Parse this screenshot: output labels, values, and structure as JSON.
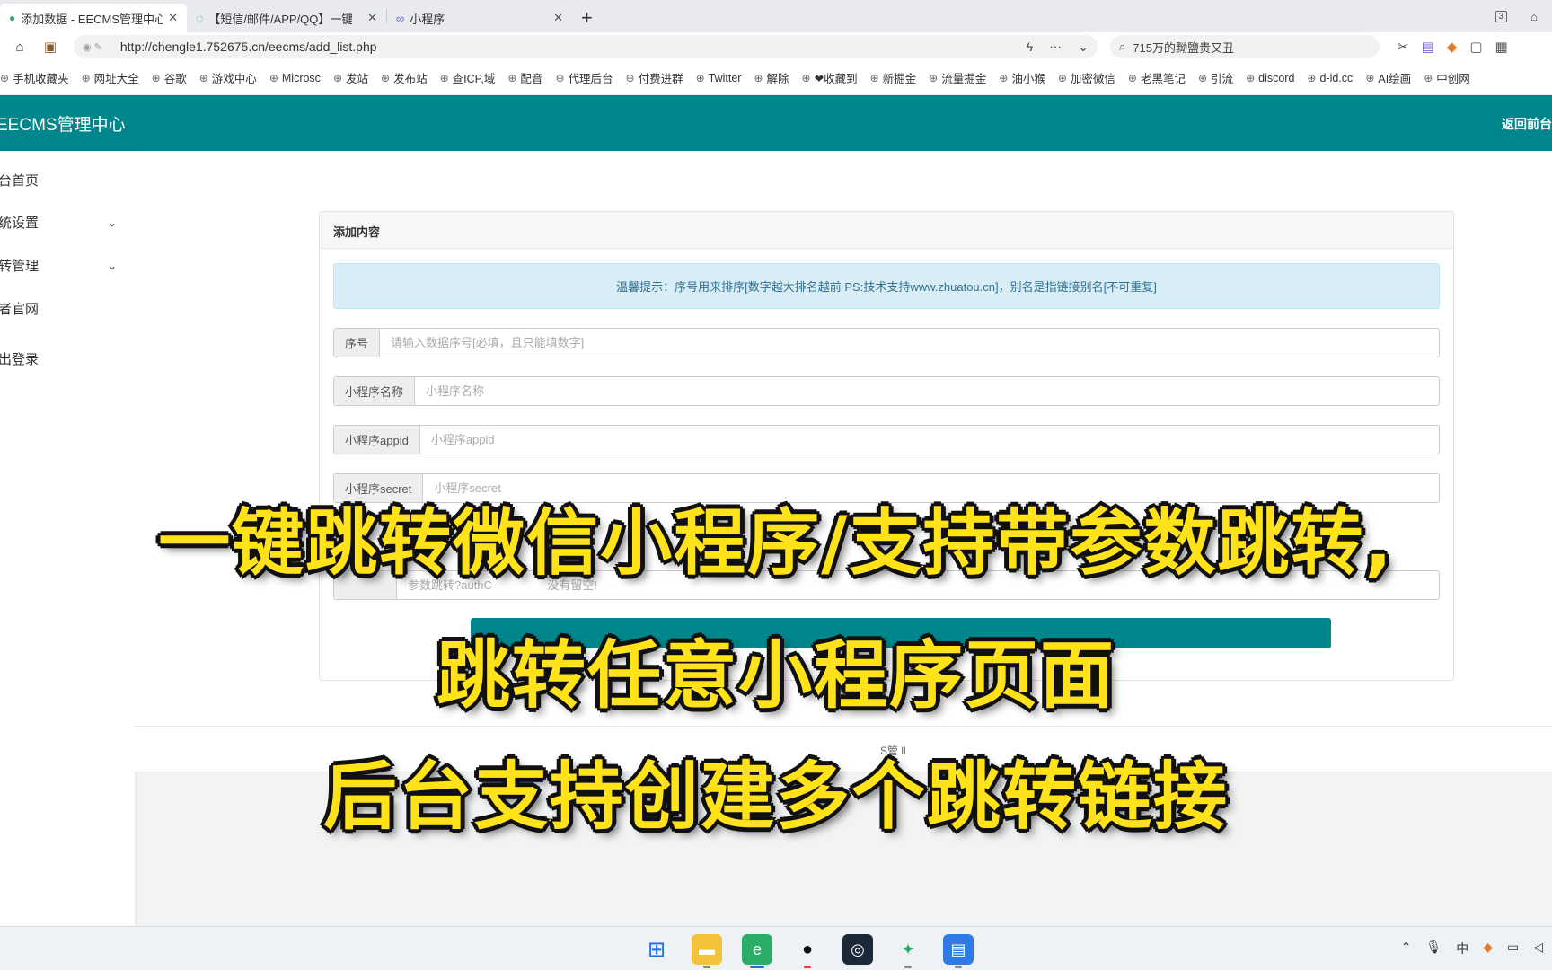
{
  "browser": {
    "tabs": [
      {
        "title": "添加数据 - EECMS管理中心",
        "active": true
      },
      {
        "title": "【短信/邮件/APP/QQ】一键跳",
        "active": false
      },
      {
        "title": "小程序",
        "active": false
      }
    ],
    "new_tab": "+",
    "tab_count_badge": "3",
    "url": "http://chengle1.752675.cn/eecms/add_list.php",
    "search_text": "715万的黝鹽贵又丑",
    "bookmarks": [
      "手机收藏夹",
      "网址大全",
      "谷歌",
      "游戏中心",
      "Microsc",
      "发站",
      "发布站",
      "查ICP,域",
      "配音",
      "代理后台",
      "付费进群",
      "Twitter",
      "解除",
      "❤收藏到",
      "新掘金",
      "流量掘金",
      "油小猴",
      "加密微信",
      "老黑笔记",
      "引流",
      "discord",
      "d-id.cc",
      "AI绘画",
      "中创网"
    ]
  },
  "header": {
    "brand": "EECMS管理中心",
    "back_link": "返回前台"
  },
  "sidebar": {
    "items": [
      {
        "label": "台首页",
        "expandable": false
      },
      {
        "label": "统设置",
        "expandable": true
      },
      {
        "label": "转管理",
        "expandable": true
      },
      {
        "label": "者官网",
        "expandable": false
      },
      {
        "label": "出登录",
        "expandable": false
      }
    ]
  },
  "form": {
    "panel_title": "添加内容",
    "tip": "温馨提示：序号用来排序[数字越大排名越前 PS:技术支持www.zhuatou.cn]，别名是指链接别名[不可重复]",
    "fields": [
      {
        "label": "序号",
        "placeholder": "请输入数据序号[必填，且只能填数字]"
      },
      {
        "label": "小程序名称",
        "placeholder": "小程序名称"
      },
      {
        "label": "小程序appid",
        "placeholder": "小程序appid"
      },
      {
        "label": "小程序secret",
        "placeholder": "小程序secret"
      }
    ],
    "partial_hint": "参数跳转?authC                 没有留空!"
  },
  "footer_fragment": "S管  ll",
  "overlay": {
    "line1": "一键跳转微信小程序/支持带参数跳转,",
    "line2": "跳转任意小程序页面",
    "line3": "后台支持创建多个跳转链接"
  },
  "colors": {
    "primary": "#00868b",
    "alert_bg": "#d9edf7",
    "alert_text": "#31708f",
    "caption": "#ffe21a"
  }
}
